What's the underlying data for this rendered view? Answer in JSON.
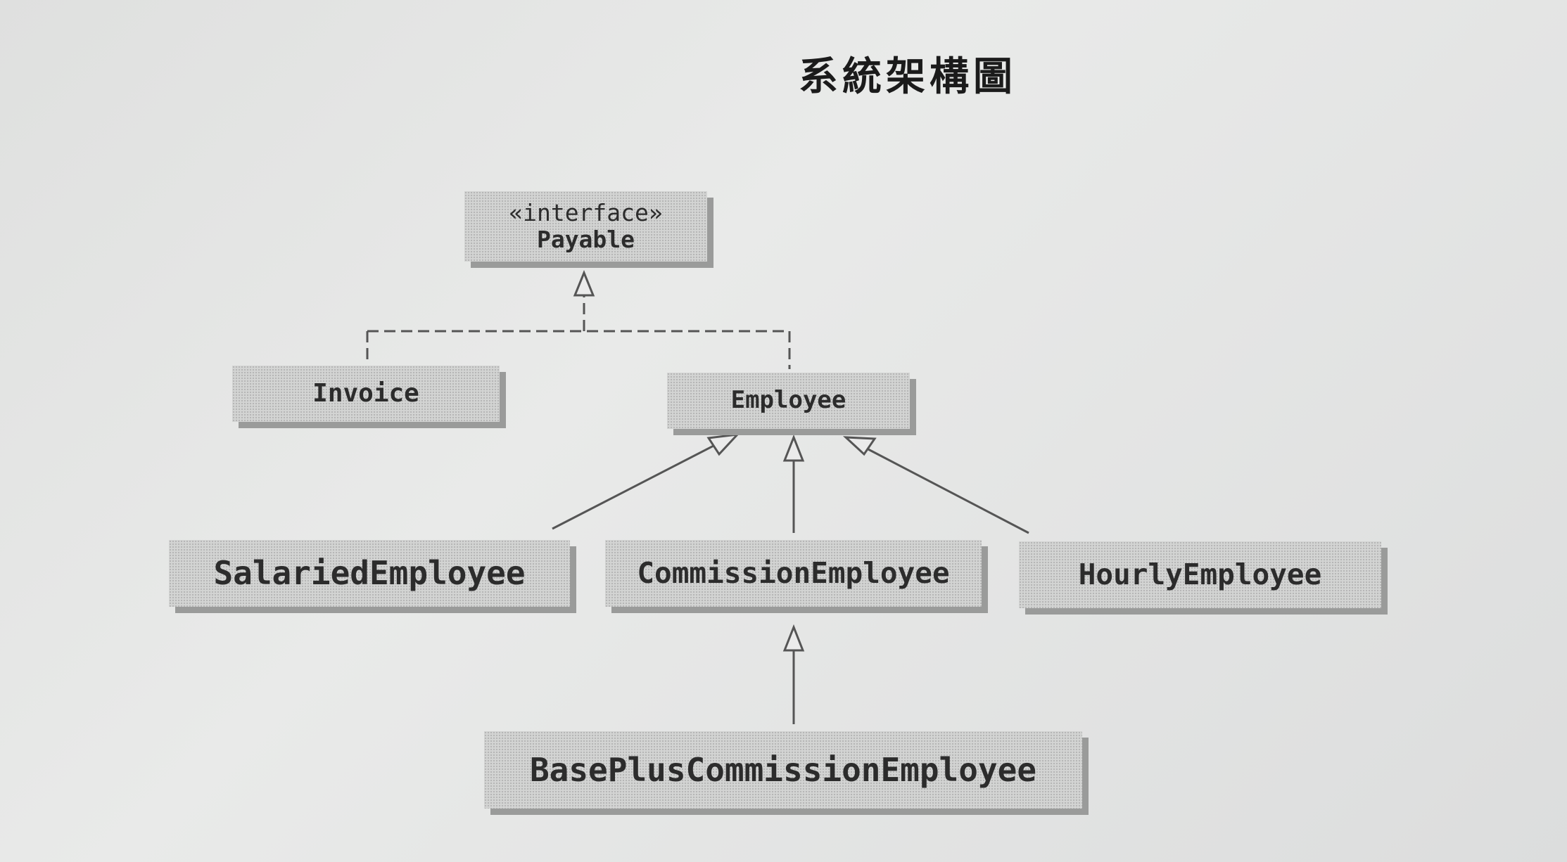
{
  "title": "系統架構圖",
  "classes": {
    "payable": {
      "stereotype": "«interface»",
      "name": "Payable"
    },
    "invoice": {
      "name": "Invoice"
    },
    "employee": {
      "name": "Employee"
    },
    "salaried": {
      "name": "SalariedEmployee"
    },
    "commission": {
      "name": "CommissionEmployee"
    },
    "hourly": {
      "name": "HourlyEmployee"
    },
    "base_plus": {
      "name": "BasePlusCommissionEmployee"
    }
  },
  "relations": [
    {
      "from": "Invoice",
      "to": "Payable",
      "type": "realization"
    },
    {
      "from": "Employee",
      "to": "Payable",
      "type": "realization"
    },
    {
      "from": "SalariedEmployee",
      "to": "Employee",
      "type": "generalization"
    },
    {
      "from": "CommissionEmployee",
      "to": "Employee",
      "type": "generalization"
    },
    {
      "from": "HourlyEmployee",
      "to": "Employee",
      "type": "generalization"
    },
    {
      "from": "BasePlusCommissionEmployee",
      "to": "CommissionEmployee",
      "type": "generalization"
    }
  ],
  "colors": {
    "box_fill": "#d3d4d3",
    "box_shadow": "#9a9b9a",
    "line": "#555555",
    "text": "#2c2c2c"
  }
}
